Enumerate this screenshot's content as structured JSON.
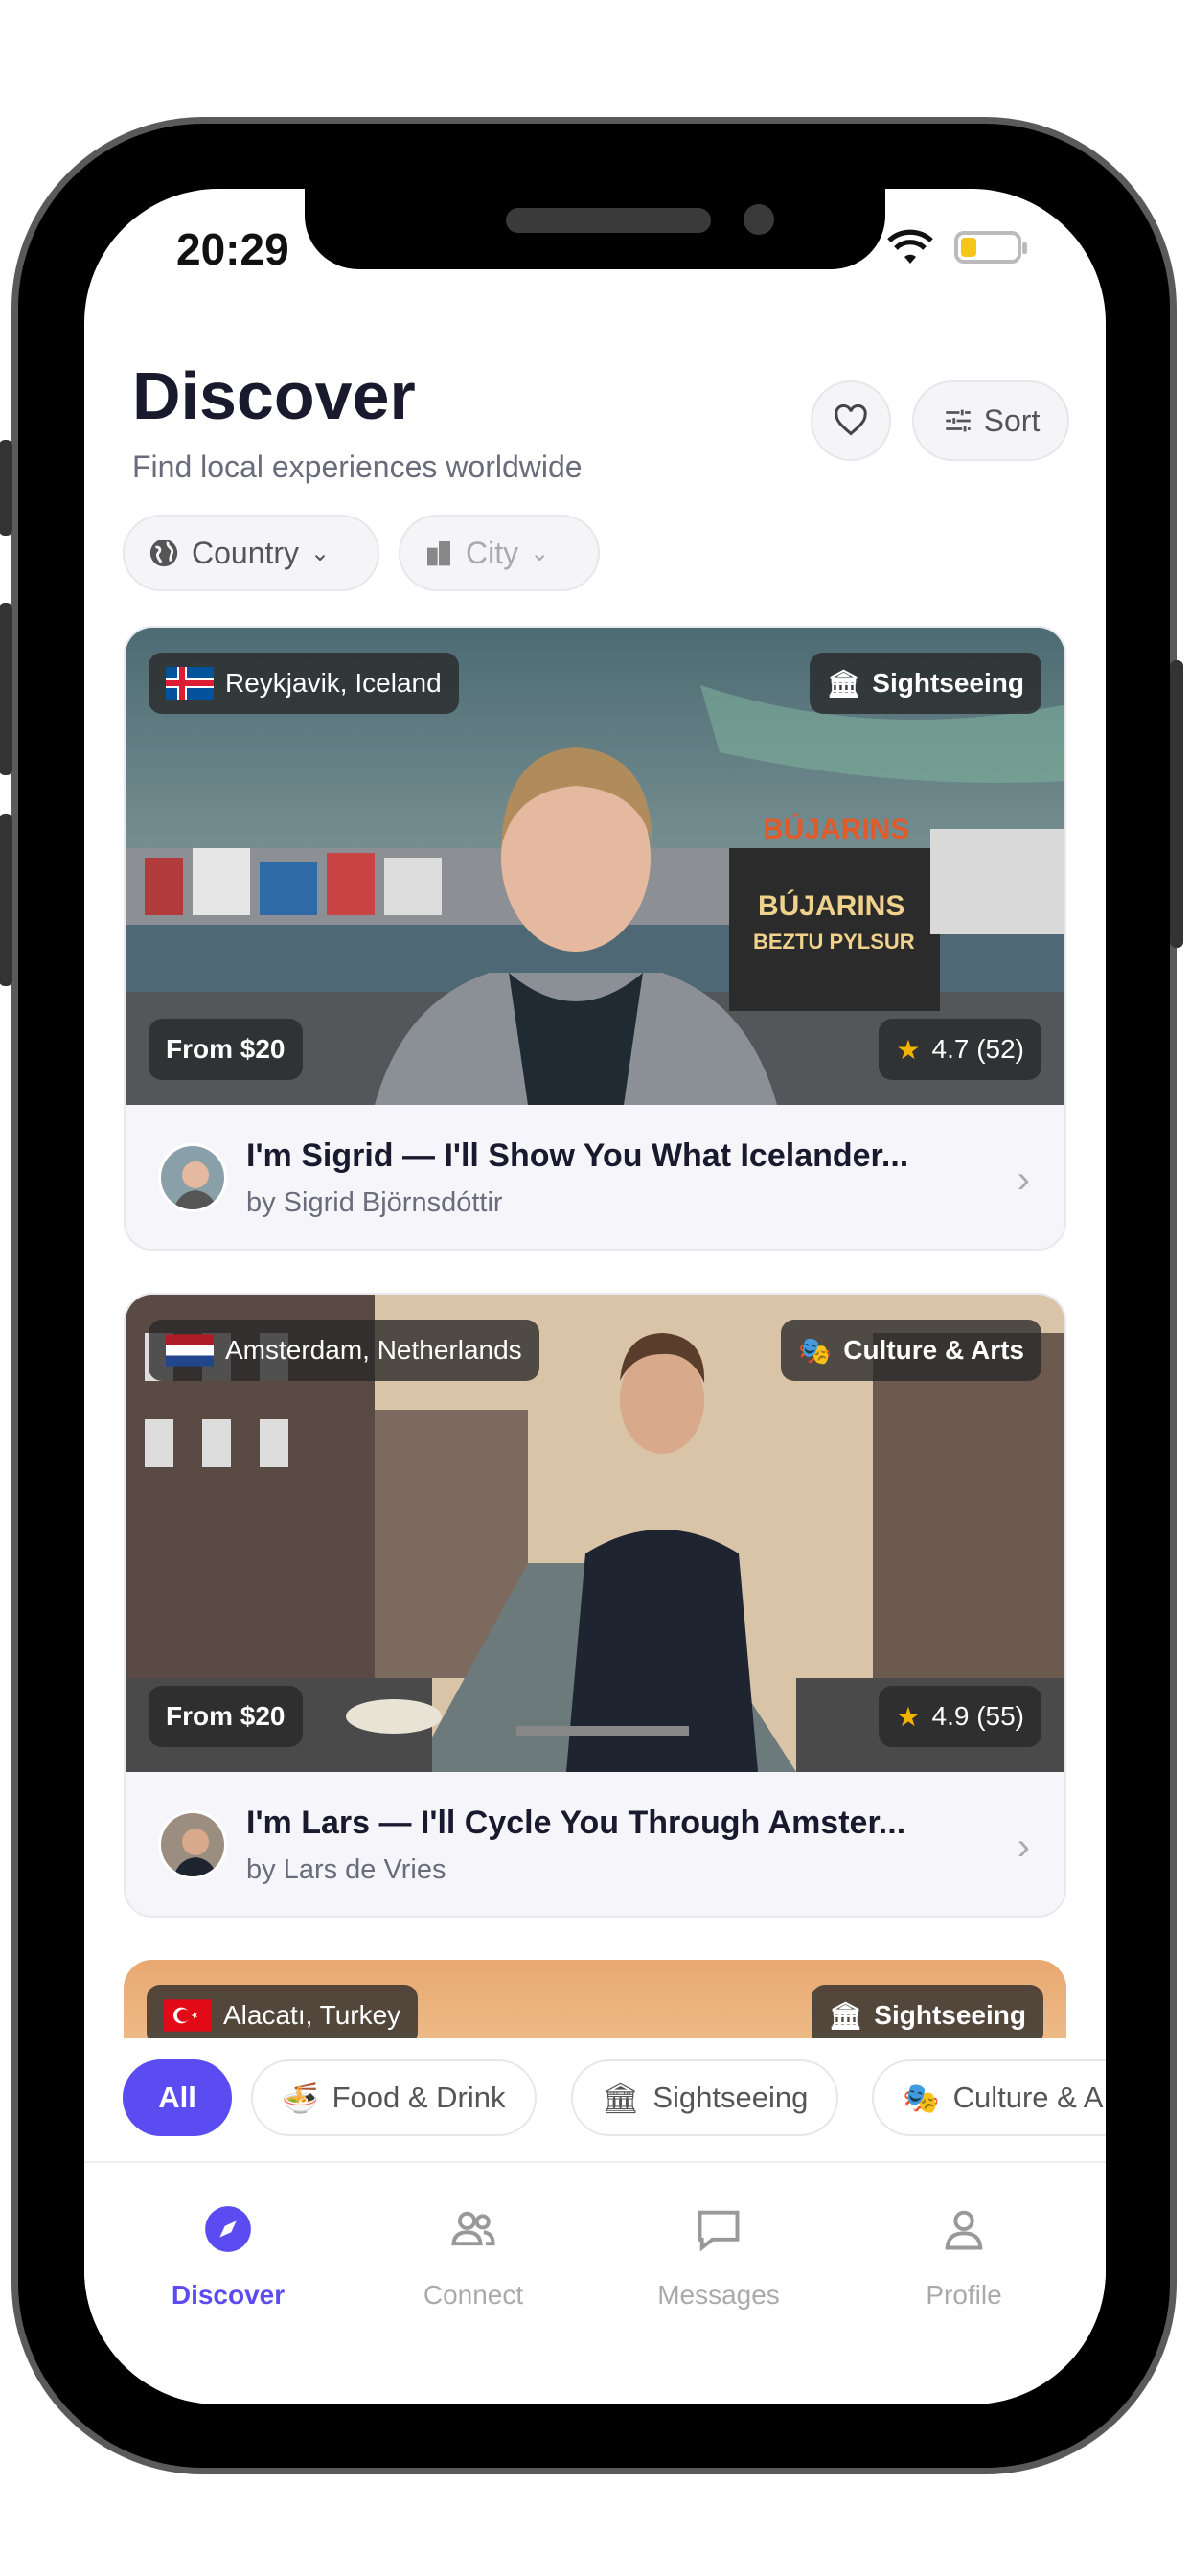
{
  "status": {
    "time": "20:29"
  },
  "header": {
    "title": "Discover",
    "subtitle": "Find local experiences worldwide",
    "sort_label": "Sort"
  },
  "filters": {
    "country_label": "Country",
    "city_label": "City"
  },
  "cards": [
    {
      "location": "Reykjavik, Iceland",
      "category": "Sightseeing",
      "price": "From $20",
      "rating": "4.7 (52)",
      "title": "I'm Sigrid — I'll Show You What Icelander...",
      "author": "by Sigrid Björnsdóttir"
    },
    {
      "location": "Amsterdam, Netherlands",
      "category": "Culture & Arts",
      "price": "From $20",
      "rating": "4.9 (55)",
      "title": "I'm Lars — I'll Cycle You Through Amster...",
      "author": "by Lars de Vries"
    },
    {
      "location": "Alacatı, Turkey",
      "category": "Sightseeing"
    }
  ],
  "categories": [
    {
      "label": "All"
    },
    {
      "label": "Food & Drink"
    },
    {
      "label": "Sightseeing"
    },
    {
      "label": "Culture & A"
    }
  ],
  "tabs": [
    {
      "label": "Discover"
    },
    {
      "label": "Connect"
    },
    {
      "label": "Messages"
    },
    {
      "label": "Profile"
    }
  ],
  "colors": {
    "accent": "#5b4cf2",
    "text": "#1a1a2e",
    "muted": "#6b6b7b"
  }
}
